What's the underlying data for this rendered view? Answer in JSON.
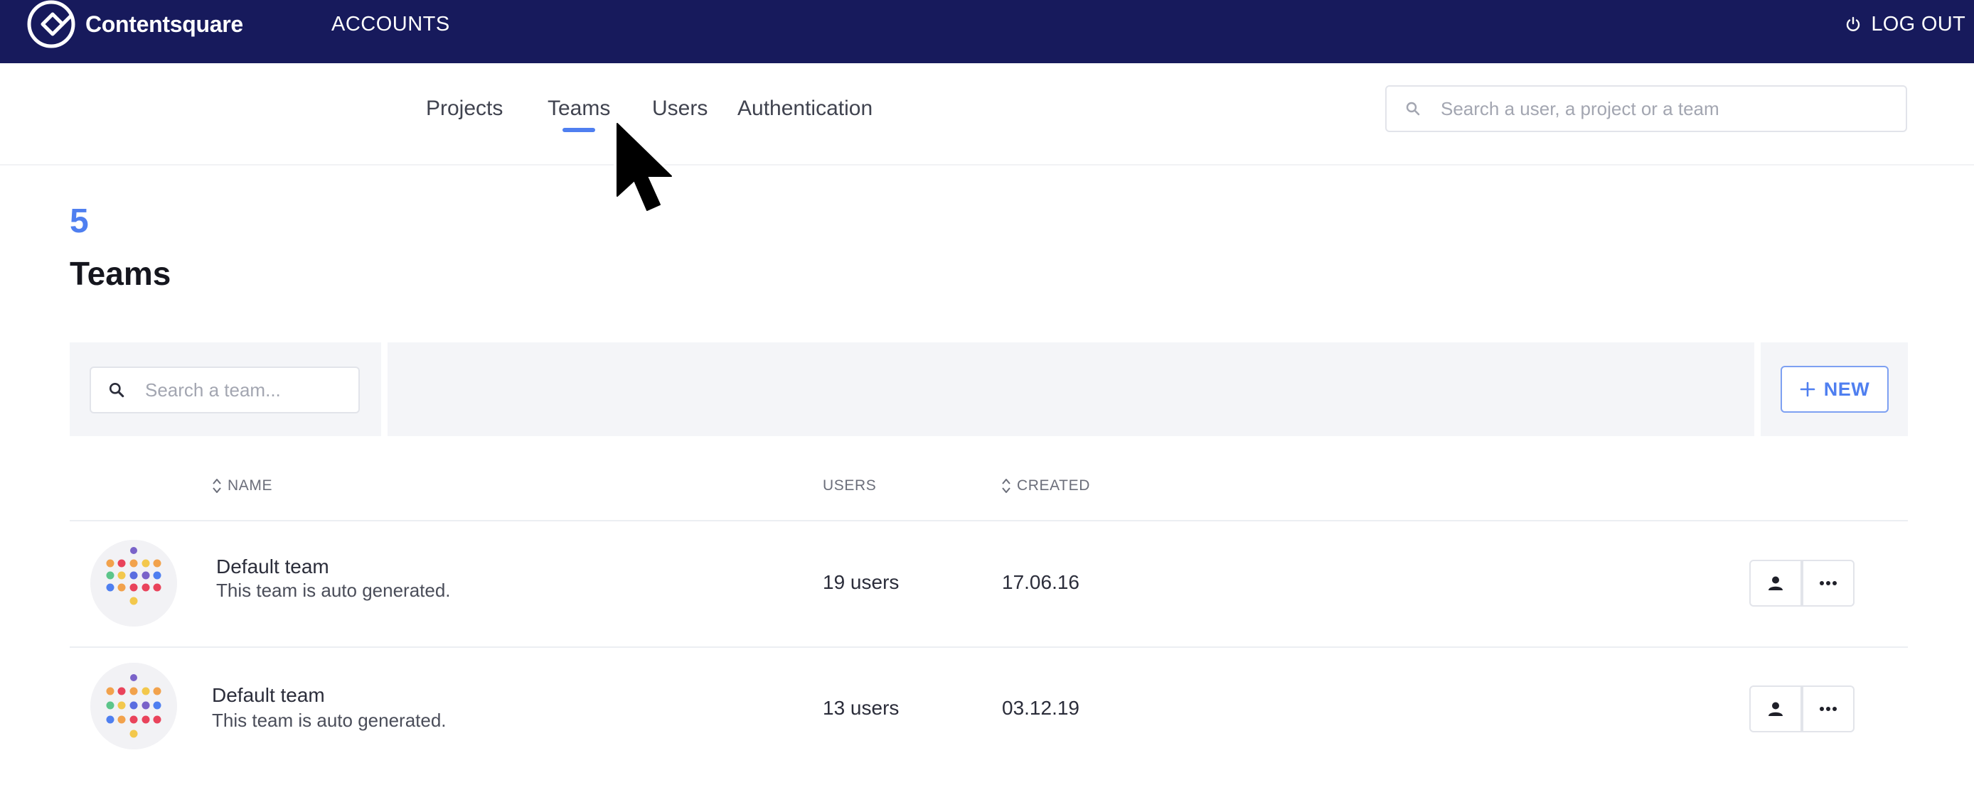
{
  "header": {
    "logo_text": "Contentsquare",
    "accounts_label": "ACCOUNTS",
    "logout_label": "LOG OUT",
    "bg_color": "#171a5c"
  },
  "subnav": {
    "tabs": [
      {
        "label": "Projects"
      },
      {
        "label": "Teams",
        "active": true
      },
      {
        "label": "Users"
      },
      {
        "label": "Authentication"
      }
    ],
    "search_placeholder": "Search a user, a project or a team"
  },
  "main": {
    "count": "5",
    "title": "Teams",
    "team_search_placeholder": "Search a team...",
    "new_button_label": "NEW",
    "accent_color": "#4f7ff0"
  },
  "table": {
    "columns": {
      "name": "NAME",
      "users": "USERS",
      "created": "CREATED"
    },
    "rows": [
      {
        "name": "Default team",
        "description": "This team is auto generated.",
        "users": "19 users",
        "created": "17.06.16"
      },
      {
        "name": "Default team",
        "description": "This team is auto generated.",
        "users": "13 users",
        "created": "03.12.19"
      }
    ]
  },
  "icons": [
    "logo-mark-icon",
    "power-icon",
    "search-icon",
    "plus-icon",
    "sort-icon",
    "team-avatar-icon",
    "user-icon",
    "more-icon",
    "mouse-cursor-icon"
  ]
}
